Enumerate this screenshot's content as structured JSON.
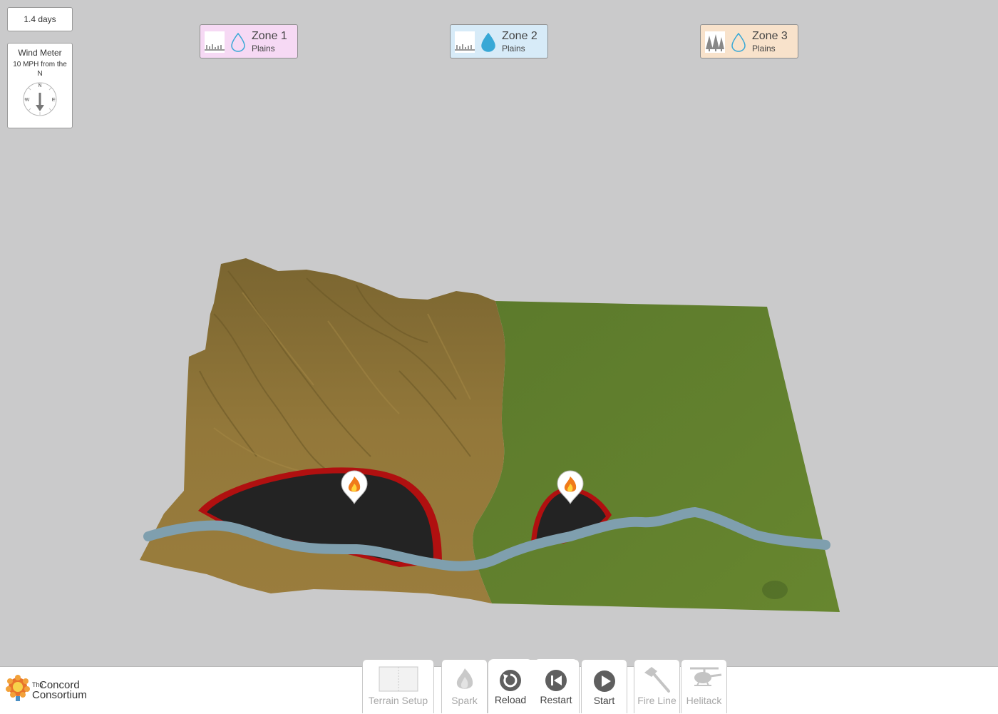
{
  "time": {
    "label": "1.4 days"
  },
  "wind": {
    "title": "Wind Meter",
    "description": "10 MPH from the N",
    "compass": {
      "n": "N",
      "e": "E",
      "w": "W"
    }
  },
  "zones": [
    {
      "name": "Zone 1",
      "terrain": "Plains",
      "bg_color": "#f6d9f4",
      "drop_filled": false,
      "vegetation_icon": "grass-icon"
    },
    {
      "name": "Zone 2",
      "terrain": "Plains",
      "bg_color": "#d7ebf8",
      "drop_filled": true,
      "vegetation_icon": "grass-icon"
    },
    {
      "name": "Zone 3",
      "terrain": "Plains",
      "bg_color": "#f8e2cb",
      "drop_filled": false,
      "vegetation_icon": "forest-icon"
    }
  ],
  "toolbar": {
    "terrain_setup": "Terrain Setup",
    "spark": "Spark",
    "reload": "Reload",
    "restart": "Restart",
    "start": "Start",
    "fire_line": "Fire Line",
    "helitack": "Helitack"
  },
  "logo": {
    "line1": "The",
    "line2": "Concord",
    "line3": "Consortium"
  },
  "colors": {
    "zone_brown": "#8c7334",
    "zone_green": "#63812f",
    "burnt": "#232323",
    "fire_edge": "#b01010",
    "river": "#7f9fae"
  }
}
